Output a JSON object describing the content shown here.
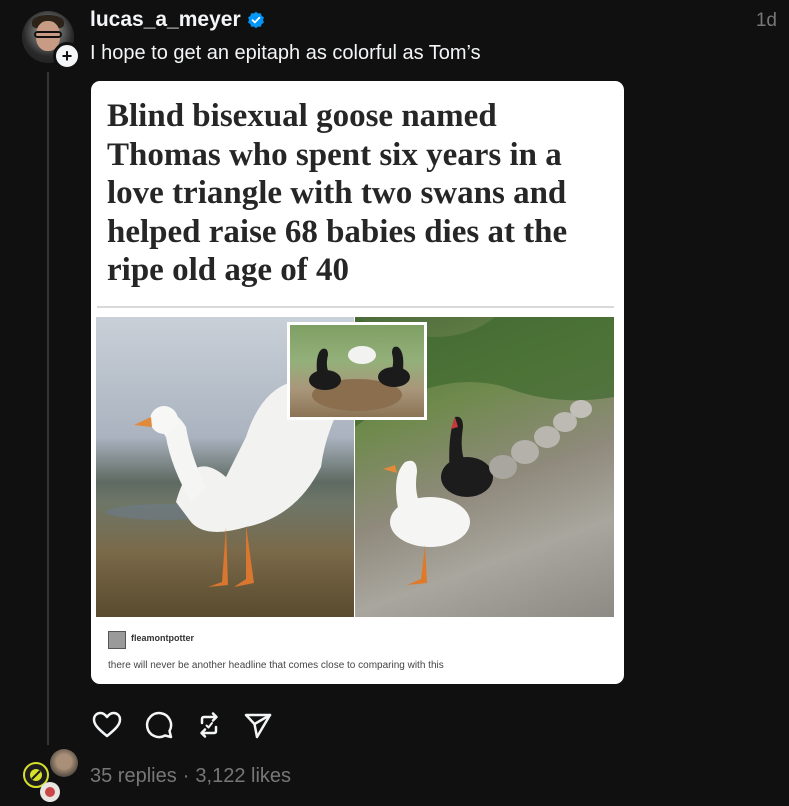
{
  "post": {
    "username": "lucas_a_meyer",
    "verified": true,
    "time_ago": "1d",
    "caption": "I hope to get an epitaph as colorful as Tom’s"
  },
  "embedded": {
    "headline": "Blind bisexual goose named Thomas who spent six years in a love triangle with two swans and helped raise 68 babies dies at the ripe old age of 40",
    "blog_name": "fleamontpotter",
    "blog_text": "there will never be another headline that comes close to comparing with this"
  },
  "actions": {
    "icons": [
      "heart-icon",
      "comment-icon",
      "repost-icon",
      "share-icon"
    ]
  },
  "stats": {
    "replies": "35 replies",
    "separator": "·",
    "likes": "3,122 likes"
  },
  "colors": {
    "background": "#101010",
    "text": "#f3f5f7",
    "muted": "#777777",
    "verified": "#0095f6"
  }
}
